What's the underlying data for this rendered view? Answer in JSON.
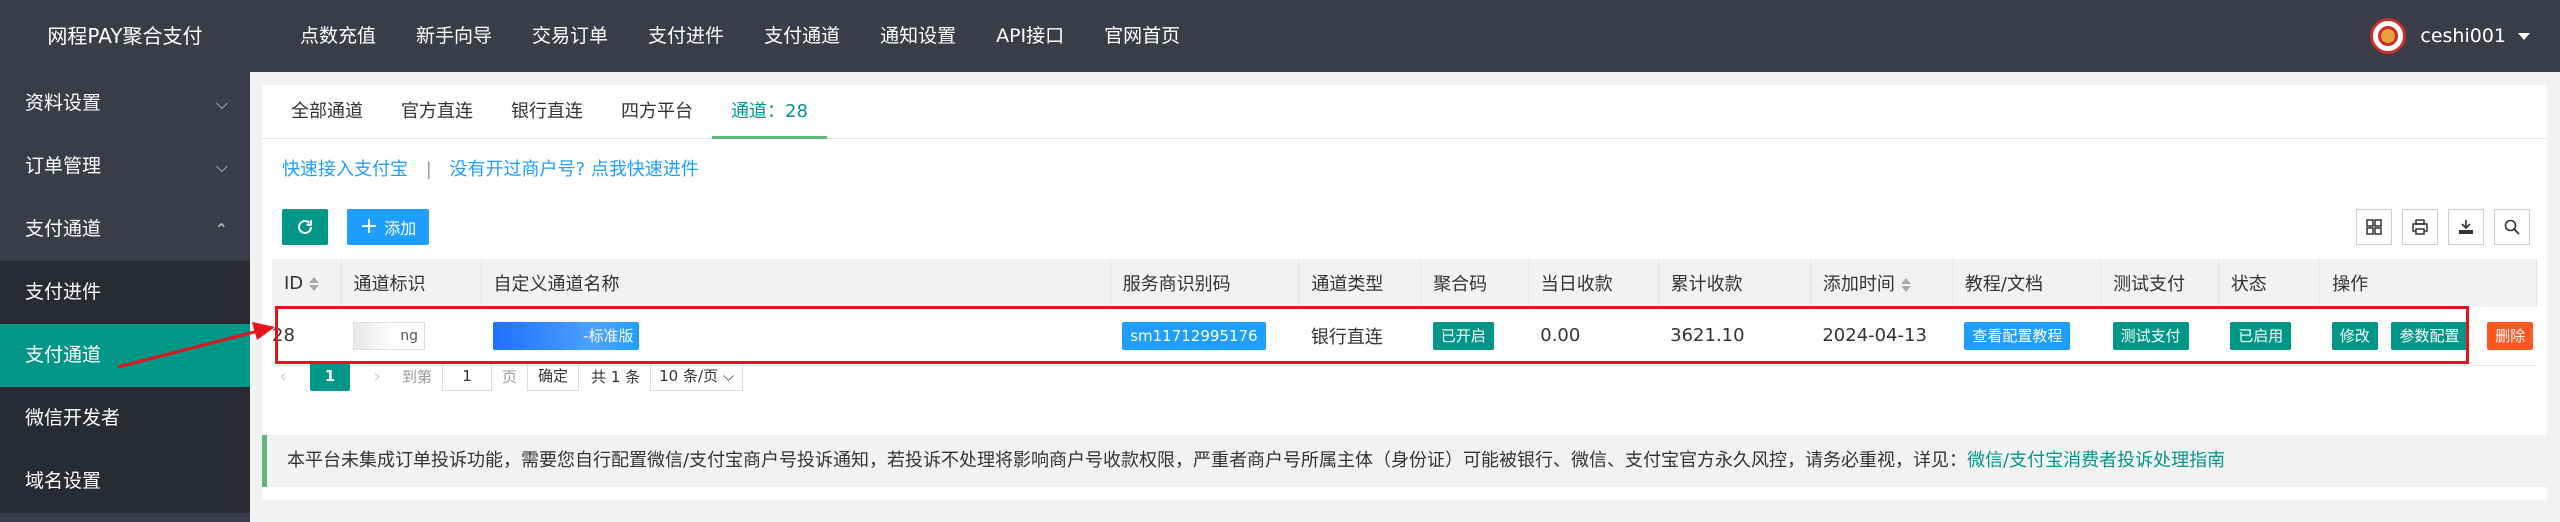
{
  "app": {
    "logo": "网程PAY聚合支付"
  },
  "topnav": [
    "点数充值",
    "新手向导",
    "交易订单",
    "支付进件",
    "支付通道",
    "通知设置",
    "API接口",
    "官网首页"
  ],
  "user": {
    "name": "ceshi001"
  },
  "sidebar": {
    "items": [
      {
        "label": "资料设置",
        "chevron": "⌵"
      },
      {
        "label": "订单管理",
        "chevron": "⌵"
      },
      {
        "label": "支付通道",
        "chevron": "⌃"
      },
      {
        "label": "支付进件"
      },
      {
        "label": "支付通道"
      },
      {
        "label": "微信开发者"
      },
      {
        "label": "域名设置"
      }
    ]
  },
  "tabs": [
    "全部通道",
    "官方直连",
    "银行直连",
    "四方平台",
    "通道：28"
  ],
  "links": {
    "alipay": "快速接入支付宝",
    "sep": "|",
    "merchant": "没有开过商户号? 点我快速进件"
  },
  "toolbar": {
    "add_label": "添加"
  },
  "table": {
    "headers": [
      "ID",
      "通道标识",
      "自定义通道名称",
      "服务商识别码",
      "通道类型",
      "聚合码",
      "当日收款",
      "累计收款",
      "添加时间",
      "教程/文档",
      "测试支付",
      "状态",
      "操作"
    ],
    "row": {
      "id": "28",
      "ident": "ng",
      "name": "-标准版",
      "code": "sm11712995176",
      "type": "银行直连",
      "agg": "已开启",
      "today": "0.00",
      "total": "3621.10",
      "date": "2024-04-13",
      "doc": "查看配置教程",
      "test": "测试支付",
      "status": "已启用",
      "edit": "修改",
      "config": "参数配置",
      "delete": "删除"
    }
  },
  "pager": {
    "current": "1",
    "goto": "到第",
    "page_input": "1",
    "page_unit": "页",
    "confirm": "确定",
    "total": "共 1 条",
    "size": "10 条/页"
  },
  "notice": {
    "text": "本平台未集成订单投诉功能，需要您自行配置微信/支付宝商户号投诉通知，若投诉不处理将影响商户号收款权限，严重者商户号所属主体（身份证）可能被银行、微信、支付宝官方永久风控，请务必重视，详见：",
    "link": "微信/支付宝消费者投诉处理指南"
  },
  "colors": {
    "accent": "#009688",
    "blue": "#1e9fff",
    "danger": "#ff5722",
    "dark": "#393d49",
    "highlight": "#e5141c"
  }
}
